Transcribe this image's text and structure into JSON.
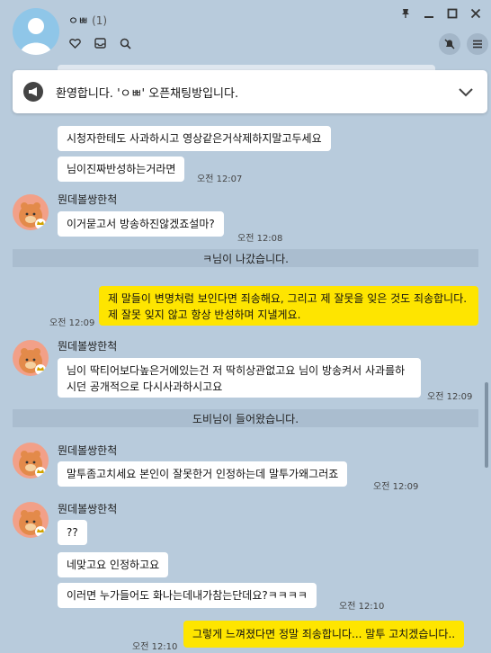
{
  "header": {
    "room_name": "ㅇㅃ",
    "member_count": "(1)",
    "icons": [
      "heart-icon",
      "inbox-icon",
      "search-icon"
    ]
  },
  "notice": {
    "text": "환영합니다. 'ㅇㅃ' 오픈채팅방입니다."
  },
  "messages": {
    "m1": "시청자한테도 사과하시고 영상같은거삭제하지말고두세요",
    "m2": "님이진짜반성하는거라면",
    "t1": "오전 12:07",
    "sender1": "뭔데볼쌍한척",
    "m3": "이거묻고서 방송하진않겠죠설마?",
    "t2": "오전 12:08",
    "sys1": "ㅋ님이 나갔습니다.",
    "m4": "제 말들이 변명처럼 보인다면 죄송해요, 그리고 제 잘못을 잊은 것도 죄송합니다. 제 잘못 잊지 않고 항상 반성하며 지낼게요.",
    "t3": "오전 12:09",
    "sender2": "뭔데볼쌍한척",
    "m5": "님이 딱티어보다높은거에있는건 저 딱히상관없고요 님이 방송켜서 사과를하시던 공개적으로 다시사과하시고요",
    "t4": "오전 12:09",
    "sys2": "도비님이 들어왔습니다.",
    "sender3": "뭔데볼쌍한척",
    "m6": "말투좀고치세요 본인이 잘못한거 인정하는데 말투가왜그러죠",
    "t5": "오전 12:09",
    "sender4": "뭔데볼쌍한척",
    "m7": "??",
    "m8": "네맞고요 인정하고요",
    "m9": "이러면 누가들어도 화나는데내가참는단데요?ㅋㅋㅋㅋ",
    "t6": "오전 12:10",
    "m10": "그렇게 느껴졌다면 정말 죄송합니다... 말투 고치겠습니다..",
    "t7": "오전 12:10"
  },
  "colors": {
    "background": "#b8cbdc",
    "my_bubble": "#fee500",
    "other_bubble": "#ffffff"
  }
}
